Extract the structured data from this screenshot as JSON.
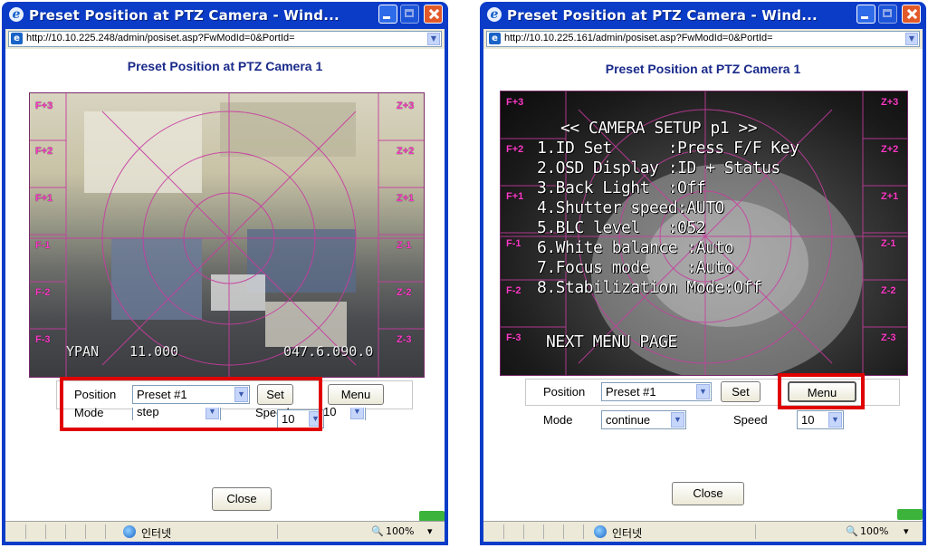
{
  "windows": [
    {
      "title": "Preset Position at PTZ Camera - Wind...",
      "url": "http://10.10.225.248/admin/posiset.asp?FwModId=0&PortId=",
      "heading": "Preset Position at PTZ Camera 1",
      "zones_left": [
        "F+3",
        "F+2",
        "F+1",
        "F-1",
        "F-2",
        "F-3"
      ],
      "zones_right": [
        "Z+3",
        "Z+2",
        "Z+1",
        "Z-1",
        "Z-2",
        "Z-3"
      ],
      "osd": {
        "pan": "YPAN",
        "pan_value": "11.000",
        "right_value": "047.6.090.0"
      },
      "position_label": "Position",
      "position_value": "Preset #1",
      "set_label": "Set",
      "menu_label": "Menu",
      "mode_label": "Mode",
      "mode_value": "step",
      "speed_label": "Speed",
      "speed_value": "10",
      "close_label": "Close",
      "status_zone": "인터넷",
      "zoom": "100%"
    },
    {
      "title": "Preset Position at PTZ Camera - Wind...",
      "url": "http://10.10.225.161/admin/posiset.asp?FwModId=0&PortId=",
      "heading": "Preset Position at PTZ Camera 1",
      "zones_left": [
        "F+3",
        "F+2",
        "F+1",
        "F-1",
        "F-2",
        "F-3"
      ],
      "zones_right": [
        "Z+3",
        "Z+2",
        "Z+1",
        "Z-1",
        "Z-2",
        "Z-3"
      ],
      "osd_menu": {
        "title": "<< CAMERA SETUP p1 >>",
        "items": [
          "1.ID Set      :Press F/F Key",
          "2.OSD Display :ID + Status",
          "3.Back Light  :Off",
          "4.Shutter speed:AUTO",
          "5.BLC level   :052",
          "6.White balance :Auto",
          "7.Focus mode    :Auto",
          "8.Stabilization Mode:Off"
        ],
        "footer": "NEXT MENU PAGE"
      },
      "position_label": "Position",
      "position_value": "Preset #1",
      "set_label": "Set",
      "menu_label": "Menu",
      "mode_label": "Mode",
      "mode_value": "continue",
      "speed_label": "Speed",
      "speed_value": "10",
      "close_label": "Close",
      "status_zone": "인터넷",
      "zoom": "100%"
    }
  ],
  "colors": {
    "titlebar": "#0a3cc8",
    "highlight": "#e00000",
    "zone_text": "#ff3cc8",
    "heading": "#1a2a8a"
  }
}
